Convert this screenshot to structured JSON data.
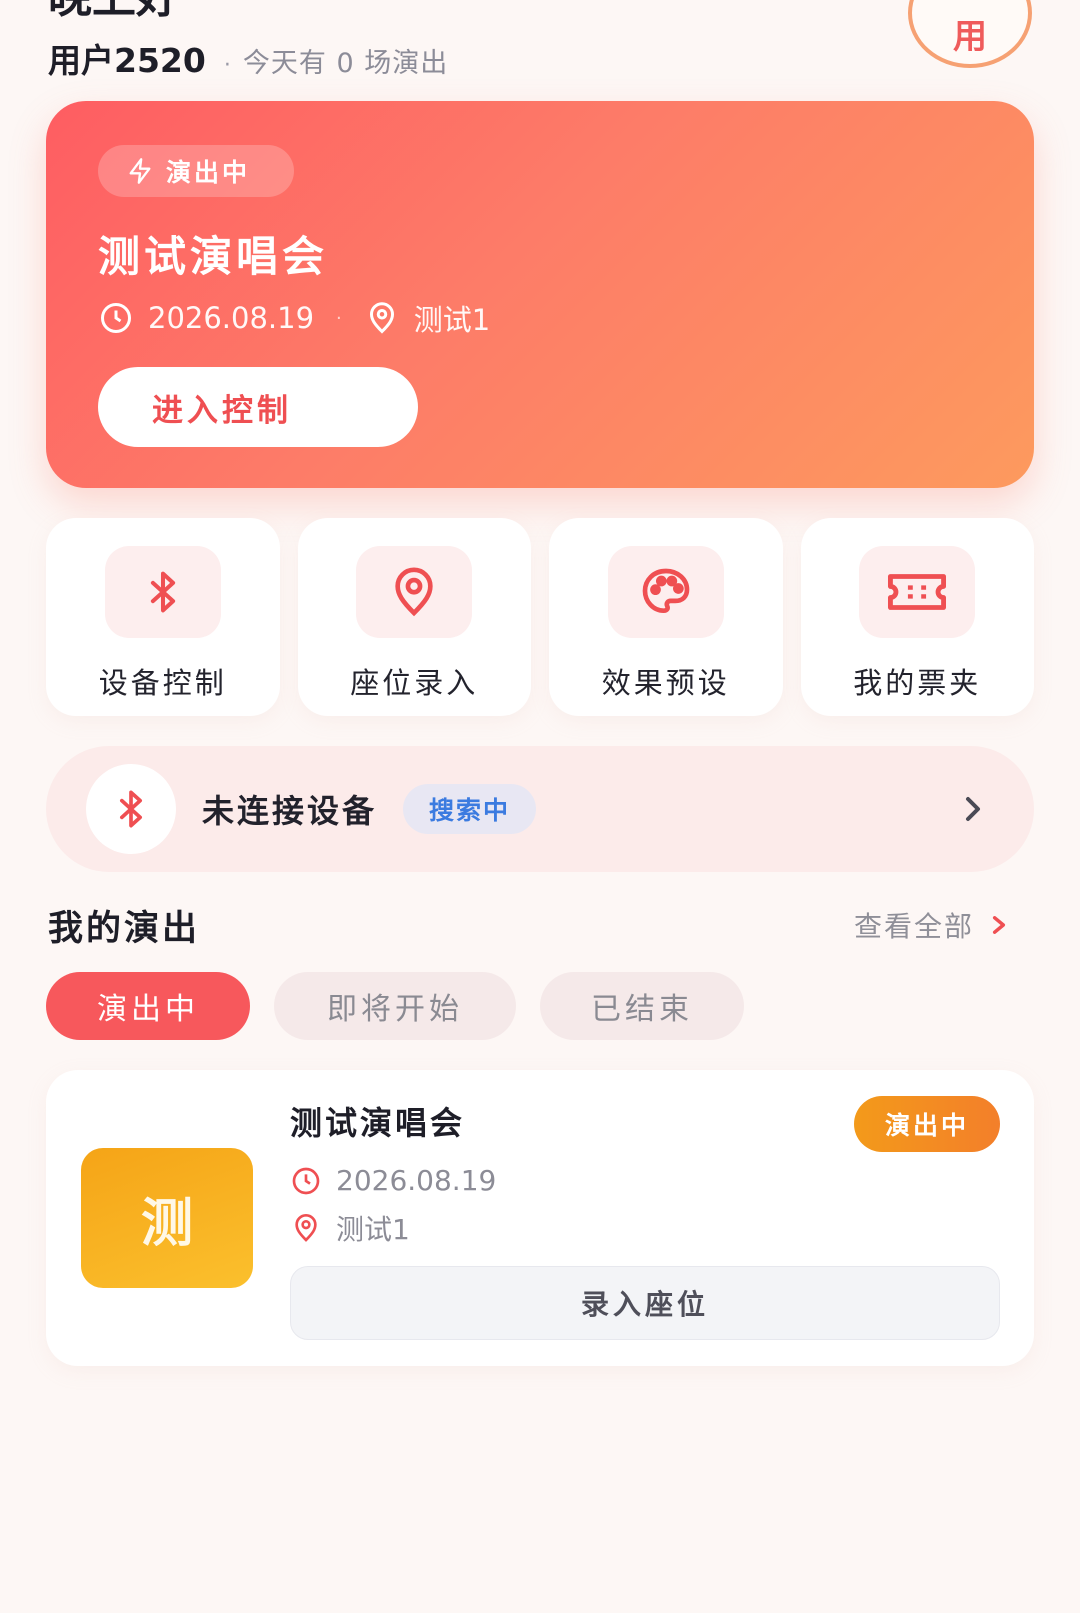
{
  "header": {
    "greeting": "晚上好",
    "username": "用户2520",
    "separator": "·",
    "show_count_text": "今天有 0 场演出",
    "avatar_char": "用"
  },
  "hero": {
    "badge": "演出中",
    "title": "测试演唱会",
    "date": "2026.08.19",
    "separator": "·",
    "venue": "测试1",
    "button": "进入控制",
    "colors": {
      "start": "#fe5d62",
      "end": "#fd9a5e"
    }
  },
  "features": [
    {
      "label": "设备控制",
      "icon": "bluetooth-icon"
    },
    {
      "label": "座位录入",
      "icon": "location-pin-icon"
    },
    {
      "label": "效果预设",
      "icon": "palette-icon"
    },
    {
      "label": "我的票夹",
      "icon": "ticket-icon"
    }
  ],
  "device": {
    "status": "未连接设备",
    "badge": "搜索中",
    "icon": "bluetooth-icon"
  },
  "my_shows": {
    "title": "我的演出",
    "view_all": "查看全部",
    "tabs": [
      "演出中",
      "即将开始",
      "已结束"
    ],
    "active_tab": "演出中"
  },
  "show_card": {
    "thumb_char": "测",
    "title": "测试演唱会",
    "status": "演出中",
    "date": "2026.08.19",
    "venue": "测试1",
    "button": "录入座位"
  },
  "colors": {
    "accent": "#f7585c",
    "status_orange": "#f39a1a",
    "link_blue": "#3b7be0"
  }
}
